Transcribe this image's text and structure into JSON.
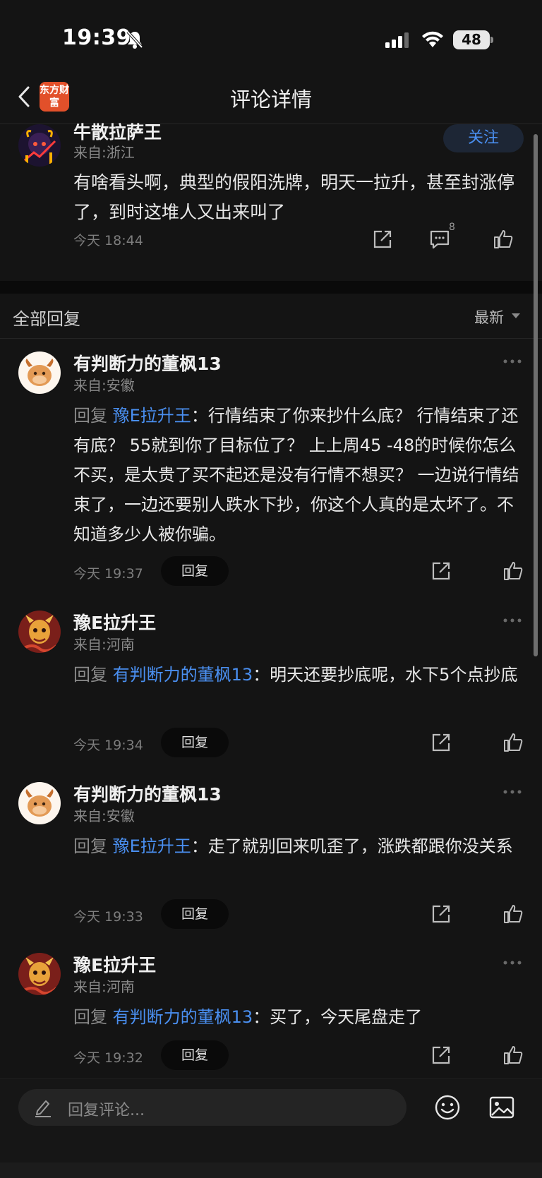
{
  "status": {
    "time": "19:39",
    "battery": "48"
  },
  "nav": {
    "title": "评论详情",
    "logo_text": "东方财富"
  },
  "main_comment": {
    "username": "牛散拉萨王",
    "location": "来自:浙江",
    "follow_label": "关注",
    "text": "有啥看头啊，典型的假阳洗牌，明天一拉升，甚至封涨停了，到时这堆人又出来叫了",
    "time": "今天 18:44",
    "comment_count": "8"
  },
  "replies_header": {
    "title": "全部回复",
    "sort": "最新"
  },
  "replies": [
    {
      "username": "有判断力的董枫13",
      "location": "来自:安徽",
      "prefix": "回复",
      "target": "豫E拉升王",
      "text": "：行情结束了你来抄什么底？ 行情结束了还有底？ 55就到你了目标位了？ 上上周45 -48的时候你怎么不买，是太贵了买不起还是没有行情不想买？ 一边说行情结束了，一边还要别人跌水下抄，你这个人真的是太坏了。不知道多少人被你骗。",
      "time": "今天 19:37",
      "reply_label": "回复"
    },
    {
      "username": "豫E拉升王",
      "location": "来自:河南",
      "prefix": "回复",
      "target": "有判断力的董枫13",
      "text": "：明天还要抄底呢，水下5个点抄底",
      "time": "今天 19:34",
      "reply_label": "回复"
    },
    {
      "username": "有判断力的董枫13",
      "location": "来自:安徽",
      "prefix": "回复",
      "target": "豫E拉升王",
      "text": "：走了就别回来叽歪了，涨跌都跟你没关系",
      "time": "今天 19:33",
      "reply_label": "回复"
    },
    {
      "username": "豫E拉升王",
      "location": "来自:河南",
      "prefix": "回复",
      "target": "有判断力的董枫13",
      "text": "：买了，今天尾盘走了",
      "time": "今天 19:32",
      "reply_label": "回复"
    }
  ],
  "bottom": {
    "placeholder": "回复评论..."
  },
  "colors": {
    "accent": "#4a8ff0",
    "background": "#141414",
    "brand": "#e2502a"
  }
}
